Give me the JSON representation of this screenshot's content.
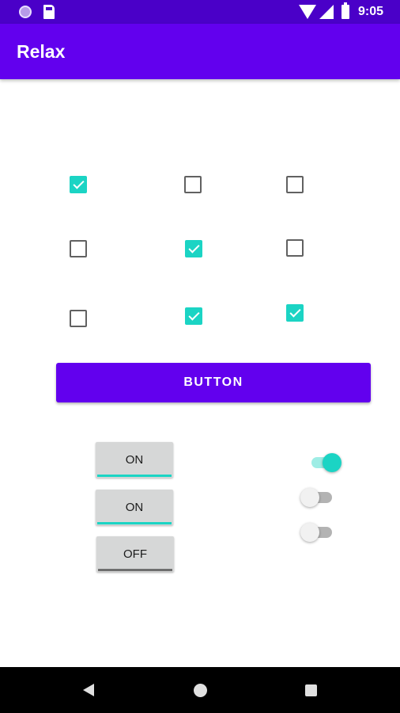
{
  "status_bar": {
    "time": "9:05",
    "icons": [
      "notification-dot-icon",
      "sd-card-icon",
      "wifi-icon",
      "signal-icon",
      "battery-icon"
    ]
  },
  "app_bar": {
    "title": "Relax",
    "color": "#6200ee"
  },
  "checkbox_grid": [
    [
      true,
      false,
      false
    ],
    [
      false,
      true,
      false
    ],
    [
      false,
      true,
      true
    ]
  ],
  "main_button": {
    "label": "BUTTON"
  },
  "toggle_buttons": [
    {
      "label": "ON",
      "checked": true
    },
    {
      "label": "ON",
      "checked": true
    },
    {
      "label": "OFF",
      "checked": false
    }
  ],
  "switches": [
    {
      "checked": true
    },
    {
      "checked": false
    },
    {
      "checked": false
    }
  ],
  "colors": {
    "accent": "#1bd4c4",
    "primary": "#6200ee",
    "status_bar": "#4a00c8"
  },
  "nav_bar": {
    "icons": [
      "back-icon",
      "home-icon",
      "recents-icon"
    ]
  }
}
